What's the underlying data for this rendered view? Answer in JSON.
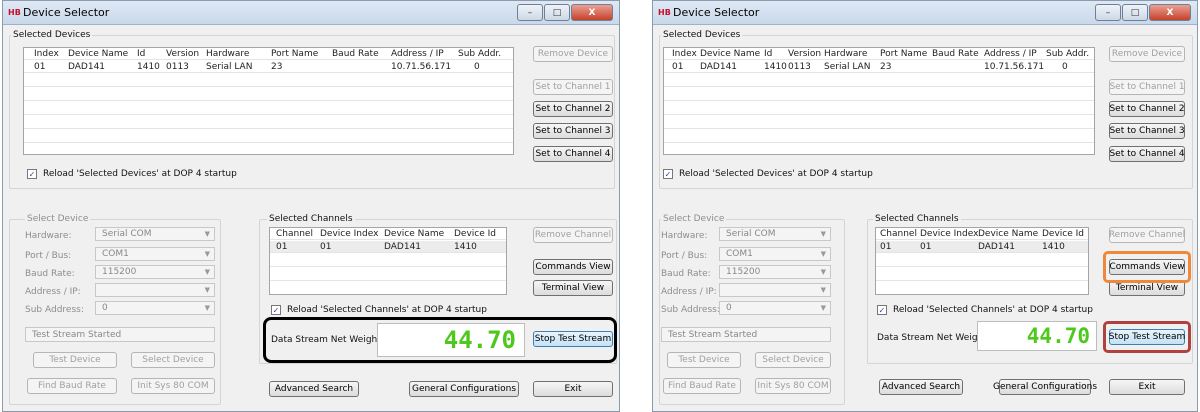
{
  "window": {
    "logo": "HB",
    "title": "Device Selector",
    "minimize_glyph": "–",
    "maximize_glyph": "□",
    "close_glyph": "X"
  },
  "selected_devices": {
    "group_label": "Selected Devices",
    "columns": [
      "Index",
      "Device Name",
      "Id",
      "Version",
      "Hardware",
      "Port Name",
      "Baud Rate",
      "Address / IP",
      "Sub Addr."
    ],
    "rows": [
      [
        "01",
        "DAD141",
        "1410",
        "0113",
        "Serial LAN",
        "23",
        "",
        "10.71.56.171",
        "0"
      ]
    ],
    "reload_label": "Reload 'Selected Devices' at DOP 4 startup",
    "reload_checked": true
  },
  "device_buttons": {
    "remove_device": "Remove Device",
    "set_channel_1": "Set to Channel 1",
    "set_channel_2": "Set to Channel 2",
    "set_channel_3": "Set to Channel 3",
    "set_channel_4": "Set to Channel 4"
  },
  "select_device": {
    "group_label": "Select Device",
    "hardware_label": "Hardware:",
    "hardware_value": "Serial COM",
    "port_label": "Port / Bus:",
    "port_value": "COM1",
    "baud_label": "Baud Rate:",
    "baud_value": "115200",
    "address_label": "Address / IP:",
    "address_value": "",
    "sub_label": "Sub Address:",
    "sub_value": "0",
    "status_text": "Test Stream Started",
    "test_device": "Test Device",
    "select_device_btn": "Select Device",
    "find_baud": "Find Baud Rate",
    "init_sys": "Init Sys 80 COM"
  },
  "selected_channels": {
    "group_label": "Selected Channels",
    "columns": [
      "Channel",
      "Device Index",
      "Device Name",
      "Device Id"
    ],
    "rows": [
      [
        "01",
        "01",
        "DAD141",
        "1410"
      ]
    ],
    "reload_label": "Reload 'Selected Channels' at DOP 4 startup",
    "reload_checked": true
  },
  "channel_buttons": {
    "remove_channel": "Remove Channel",
    "commands_view": "Commands View",
    "terminal_view": "Terminal View"
  },
  "stream": {
    "label": "Data Stream Net Weight:",
    "value": "44.70",
    "stop_button": "Stop Test Stream"
  },
  "bottom_buttons": {
    "advanced_search": "Advanced Search",
    "general_configurations": "General Configurations",
    "exit": "Exit"
  },
  "highlight_colors": {
    "stream_box": "#000000",
    "commands_view": "#f0883c",
    "stop_stream": "#b0413e"
  }
}
